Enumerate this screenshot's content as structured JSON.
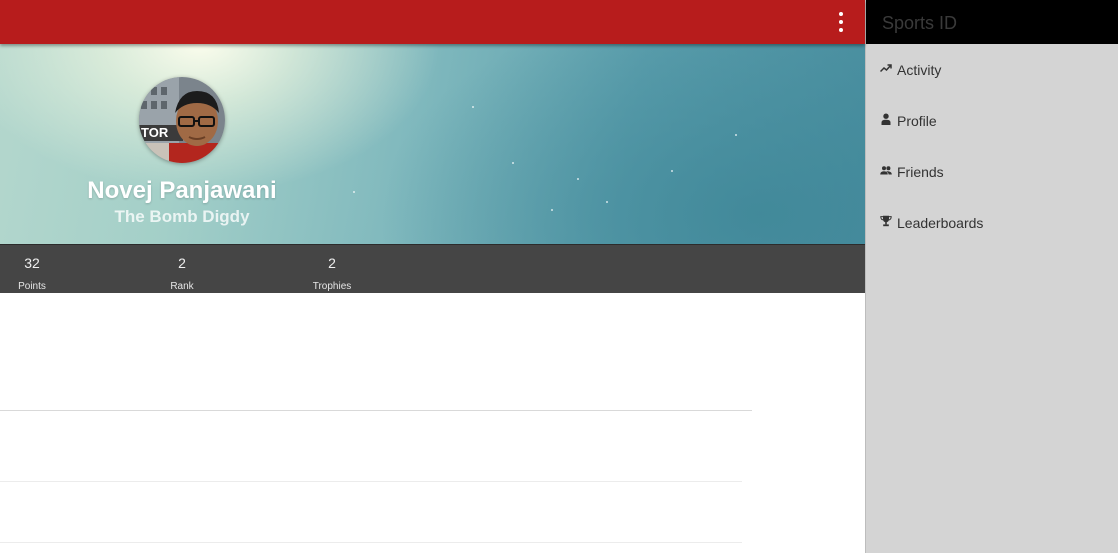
{
  "topbar": {
    "background": "#b71c1c",
    "menu_icon": "more-vert-icon"
  },
  "profile": {
    "name": "Novej Panjawani",
    "tagline": "The Bomb Digdy",
    "avatar_icon": "avatar-photo"
  },
  "stats": [
    {
      "value": "32",
      "label": "Points"
    },
    {
      "value": "2",
      "label": "Rank"
    },
    {
      "value": "2",
      "label": "Trophies"
    }
  ],
  "drawer": {
    "title": "Sports ID",
    "items": [
      {
        "label": "Activity",
        "icon": "trending-up-icon"
      },
      {
        "label": "Profile",
        "icon": "person-icon"
      },
      {
        "label": "Friends",
        "icon": "people-icon"
      },
      {
        "label": "Leaderboards",
        "icon": "trophy-icon"
      }
    ]
  },
  "colors": {
    "stats_bar": "#454545",
    "drawer_bg": "#d4d4d4",
    "drawer_header": "#000000"
  }
}
